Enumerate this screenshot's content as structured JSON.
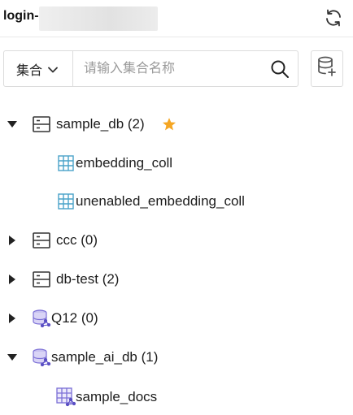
{
  "header": {
    "title": "login-"
  },
  "search": {
    "scope_label": "集合",
    "placeholder": "请输入集合名称"
  },
  "tree": [
    {
      "label": "sample_db (2)",
      "kind": "database",
      "expanded": true,
      "starred": true
    },
    {
      "label": "embedding_coll",
      "kind": "collection"
    },
    {
      "label": "unenabled_embedding_coll",
      "kind": "collection"
    },
    {
      "label": "ccc (0)",
      "kind": "database",
      "expanded": false
    },
    {
      "label": "db-test (2)",
      "kind": "database",
      "expanded": false
    },
    {
      "label": "Q12 (0)",
      "kind": "ai-database",
      "expanded": false
    },
    {
      "label": "sample_ai_db (1)",
      "kind": "ai-database",
      "expanded": true
    },
    {
      "label": "sample_docs",
      "kind": "ai-collection"
    }
  ],
  "colors": {
    "star": "#f5a623",
    "collection_icon": "#4aa3c9",
    "ai_icon": "#7b6fd6"
  }
}
